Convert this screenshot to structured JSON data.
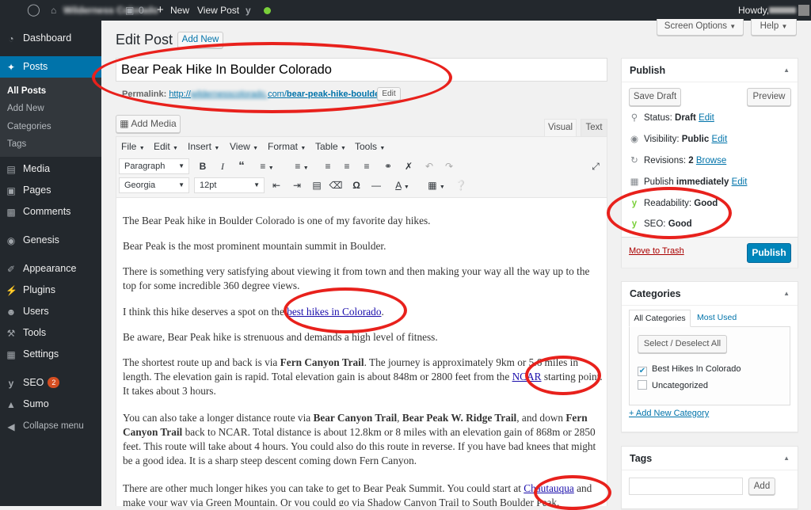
{
  "admin_bar": {
    "site_name": "Wilderness Colorado",
    "comments_count": "0",
    "new_label": "New",
    "view_post_label": "View Post",
    "howdy_label": "Howdy,"
  },
  "sidebar": {
    "dashboard": "Dashboard",
    "posts": "Posts",
    "posts_sub": [
      "All Posts",
      "Add New",
      "Categories",
      "Tags"
    ],
    "media": "Media",
    "pages": "Pages",
    "comments": "Comments",
    "genesis": "Genesis",
    "appearance": "Appearance",
    "plugins": "Plugins",
    "users": "Users",
    "tools": "Tools",
    "settings": "Settings",
    "seo": "SEO",
    "seo_badge": "2",
    "sumo": "Sumo",
    "collapse": "Collapse menu"
  },
  "screen_options": "Screen Options",
  "help": "Help",
  "page_title": "Edit Post",
  "add_new_button": "Add New",
  "post_title": "Bear Peak Hike In Boulder Colorado",
  "permalink": {
    "label": "Permalink:",
    "url_prefix": "http://",
    "url_host": "wildernesscolorado.",
    "url_domain": "com/",
    "slug": "bear-peak-hike-boulder",
    "url_suffix": "/",
    "edit_label": "Edit"
  },
  "add_media": "Add Media",
  "editor_tabs": {
    "visual": "Visual",
    "text": "Text"
  },
  "menubar": [
    "File",
    "Edit",
    "Insert",
    "View",
    "Format",
    "Table",
    "Tools"
  ],
  "format_select": "Paragraph",
  "font_select": "Georgia",
  "size_select": "12pt",
  "content": {
    "p1": "The Bear Peak hike in Boulder Colorado is one of my favorite day hikes.",
    "p2": "Bear Peak is the most prominent mountain summit in Boulder.",
    "p3": "There is something very satisfying about viewing it from town and then making your way all the way up to the top for some incredible 360 degree views.",
    "p4_pre": "I think this hike deserves a spot on the ",
    "p4_link": "best hikes in Colorado",
    "p4_post": ".",
    "p5": "Be aware, Bear Peak hike is strenuous and demands a high level of fitness.",
    "p6_a": "The shortest route up and back is via ",
    "p6_b": "Fern Canyon Trail",
    "p6_c": ". The journey is approximately 9km or 5.6 miles in length. The elevation gain is rapid. Total elevation gain is about 848m or 2800 feet from the ",
    "p6_link": "NCAR",
    "p6_d": " starting point. It takes about 3 hours.",
    "p7_a": "You can also take a longer distance route via ",
    "p7_b": "Bear Canyon Trail",
    "p7_c": ", ",
    "p7_d": "Bear Peak W. Ridge Trail",
    "p7_e": ", and down ",
    "p7_f": "Fern Canyon Trail",
    "p7_g": " back to NCAR. Total distance is about 12.8km or 8 miles with an elevation gain of 868m or 2850 feet. This route will take about 4 hours. You could also do this route in reverse. If you have bad knees that might be a good idea. It is a sharp steep descent coming down Fern Canyon.",
    "p8_pre": "There are other much longer hikes you can take to get to Bear Peak Summit. You could start at ",
    "p8_link": "Chautauqua",
    "p8_post": " and make your way via Green Mountain. Or you could go via Shadow Canyon Trail to South Boulder Peak."
  },
  "publish": {
    "title": "Publish",
    "save_draft": "Save Draft",
    "preview": "Preview",
    "status_label": "Status:",
    "status_value": "Draft",
    "visibility_label": "Visibility:",
    "visibility_value": "Public",
    "revisions_label": "Revisions:",
    "revisions_value": "2",
    "browse": "Browse",
    "schedule_label": "Publish",
    "schedule_value": "immediately",
    "edit": "Edit",
    "readability_label": "Readability:",
    "readability_value": "Good",
    "seo_label": "SEO:",
    "seo_value": "Good",
    "trash": "Move to Trash",
    "publish_button": "Publish"
  },
  "categories": {
    "title": "Categories",
    "tab_all": "All Categories",
    "tab_most": "Most Used",
    "select_all": "Select / Deselect All",
    "items": [
      {
        "label": "Best Hikes In Colorado",
        "checked": true
      },
      {
        "label": "Uncategorized",
        "checked": false
      }
    ],
    "add_new": "+ Add New Category"
  },
  "tags": {
    "title": "Tags",
    "add": "Add"
  },
  "colors": {
    "accent": "#0073aa",
    "annotation": "#e8211c",
    "yoast_good": "#7ad03a"
  }
}
